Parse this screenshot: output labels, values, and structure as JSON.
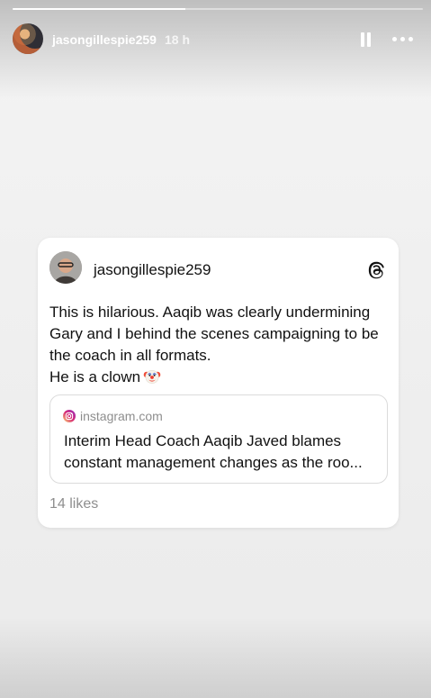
{
  "story": {
    "progress": 0.42,
    "username": "jasongillespie259",
    "time": "18 h",
    "pause_icon": "pause-icon",
    "more_icon": "more-horizontal-icon"
  },
  "post": {
    "username": "jasongillespie259",
    "app_icon": "threads-icon",
    "text_lines": [
      "This is hilarious. Aaqib was clearly undermining",
      "Gary and I behind the scenes campaigning to be",
      "the coach in all formats."
    ],
    "second_paragraph": "He is a clown",
    "emoji_icon": "clown-face-icon",
    "link": {
      "source_icon": "instagram-icon",
      "domain": "instagram.com",
      "title_lines": [
        "Interim Head Coach Aaqib Javed blames",
        "constant management changes as the roo..."
      ]
    },
    "likes": "14 likes"
  },
  "colors": {
    "card_background": "#ffffff",
    "muted_text": "#8e8e8e",
    "instagram_gradient": [
      "#feda75",
      "#d62976",
      "#962fbf"
    ]
  }
}
